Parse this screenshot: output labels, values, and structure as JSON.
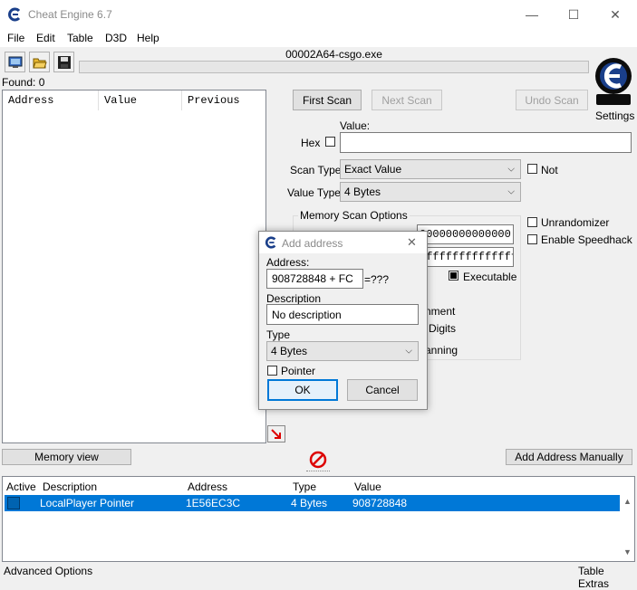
{
  "window": {
    "title": "Cheat Engine 6.7",
    "minimize_glyph": "—",
    "maximize_glyph": "☐",
    "close_glyph": "✕"
  },
  "menu": [
    "File",
    "Edit",
    "Table",
    "D3D",
    "Help"
  ],
  "process_name": "00002A64-csgo.exe",
  "found_label": "Found: 0",
  "results_table": {
    "headers": [
      "Address",
      "Value",
      "Previous"
    ]
  },
  "scan_buttons": {
    "first_scan": "First Scan",
    "next_scan": "Next Scan",
    "undo_scan": "Undo Scan"
  },
  "settings_label": "Settings",
  "value_section": {
    "value_label": "Value:",
    "hex_label": "Hex",
    "value_input": ""
  },
  "scan_type": {
    "label": "Scan Type",
    "selected": "Exact Value"
  },
  "value_type": {
    "label": "Value Type",
    "selected": "4 Bytes"
  },
  "not_label": "Not",
  "memory_scan_options": {
    "title": "Memory Scan Options",
    "start_partial": "00000000000000",
    "stop_partial": "ffffffffffffffff",
    "executable_label": "Executable",
    "partial_alignment": "nment",
    "partial_digits": "Digits",
    "partial_scanning": "anning"
  },
  "right_options": {
    "unrandomizer": "Unrandomizer",
    "enable_speedhack": "Enable Speedhack"
  },
  "add_address_dialog": {
    "title": "Add address",
    "address_label": "Address:",
    "address_value": "908728848 + FC",
    "address_result": "=???",
    "description_label": "Description",
    "description_value": "No description",
    "type_label": "Type",
    "type_selected": "4 Bytes",
    "pointer_label": "Pointer",
    "ok_label": "OK",
    "cancel_label": "Cancel"
  },
  "memory_view_button": "Memory view",
  "add_address_manually_button": "Add Address Manually",
  "address_list": {
    "headers": [
      "Active",
      "Description",
      "Address",
      "Type",
      "Value"
    ],
    "rows": [
      {
        "description": "LocalPlayer Pointer",
        "address": "1E56EC3C",
        "type": "4 Bytes",
        "value": "908728848"
      }
    ]
  },
  "footer": {
    "advanced_options": "Advanced Options",
    "table_extras": "Table Extras"
  },
  "colors": {
    "selection": "#0078d7",
    "logo": "#1a3f8a"
  }
}
